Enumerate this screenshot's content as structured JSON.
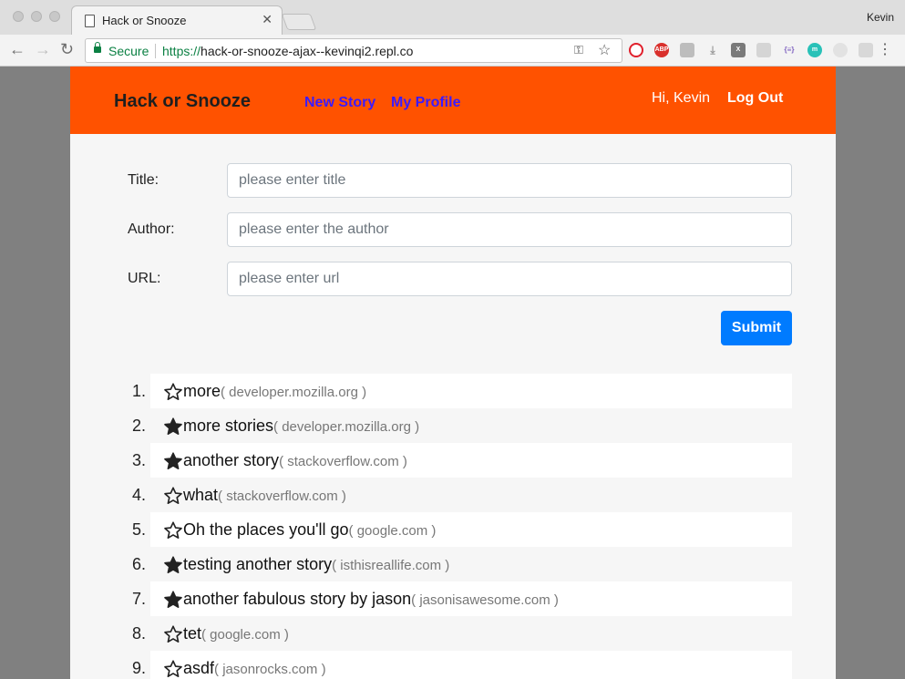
{
  "browser": {
    "tab_title": "Hack or Snooze",
    "profile_name": "Kevin",
    "secure_label": "Secure",
    "url_scheme": "https://",
    "url_rest": "hack-or-snooze-ajax--kevinqi2.repl.co",
    "extensions": [
      "opera-icon",
      "adblock-icon",
      "cube-icon",
      "download-icon",
      "x-icon",
      "puzzle-icon",
      "json-icon",
      "m-icon",
      "face-icon",
      "grid-icon"
    ]
  },
  "nav": {
    "brand": "Hack or Snooze",
    "new_story": "New Story",
    "my_profile": "My Profile",
    "greeting": "Hi, Kevin",
    "logout": "Log Out",
    "color": "#ff5200",
    "link_color": "#3b1bff"
  },
  "form": {
    "title_label": "Title:",
    "title_placeholder": "please enter title",
    "author_label": "Author:",
    "author_placeholder": "please enter the author",
    "url_label": "URL:",
    "url_placeholder": "please enter url",
    "submit_label": "Submit",
    "submit_color": "#007bff"
  },
  "stories": [
    {
      "num": "1.",
      "title": "more",
      "host": "( developer.mozilla.org )",
      "favorite": false
    },
    {
      "num": "2.",
      "title": "more stories",
      "host": "( developer.mozilla.org )",
      "favorite": true
    },
    {
      "num": "3.",
      "title": "another story",
      "host": "( stackoverflow.com )",
      "favorite": true
    },
    {
      "num": "4.",
      "title": "what",
      "host": "( stackoverflow.com )",
      "favorite": false
    },
    {
      "num": "5.",
      "title": "Oh the places you'll go",
      "host": "( google.com )",
      "favorite": false
    },
    {
      "num": "6.",
      "title": "testing another story",
      "host": "( isthisreallife.com )",
      "favorite": true
    },
    {
      "num": "7.",
      "title": "another fabulous story by jason",
      "host": "( jasonisawesome.com )",
      "favorite": true
    },
    {
      "num": "8.",
      "title": "tet",
      "host": "( google.com )",
      "favorite": false
    },
    {
      "num": "9.",
      "title": "asdf",
      "host": "( jasonrocks.com )",
      "favorite": false
    }
  ]
}
